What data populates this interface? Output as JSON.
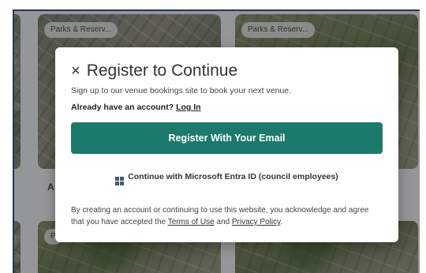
{
  "cards": [
    {
      "tag": "Parks & Reserv...",
      "partial_name": "A"
    },
    {
      "tag": "Parks & Reserv..."
    },
    {
      "tag": "P"
    }
  ],
  "modal": {
    "close_symbol": "×",
    "title": "Register to Continue",
    "subtitle": "Sign up to our venue bookings site to book your next venue.",
    "account_prompt": "Already have an account?",
    "login_link": "Log In",
    "register_button": "Register With Your Email",
    "microsoft_option": "Continue with Microsoft Entra ID (council employees)",
    "legal_prefix": "By creating an account or continuing to use this website, you acknowledge and agree that you have accepted the",
    "terms_link": "Terms of Use",
    "legal_and": "and",
    "privacy_link": "Privacy Policy",
    "legal_suffix": "."
  },
  "colors": {
    "primary": "#1b7a6b",
    "frame_border": "#1f3f86"
  },
  "icons": [
    "close-icon",
    "microsoft-icon"
  ]
}
